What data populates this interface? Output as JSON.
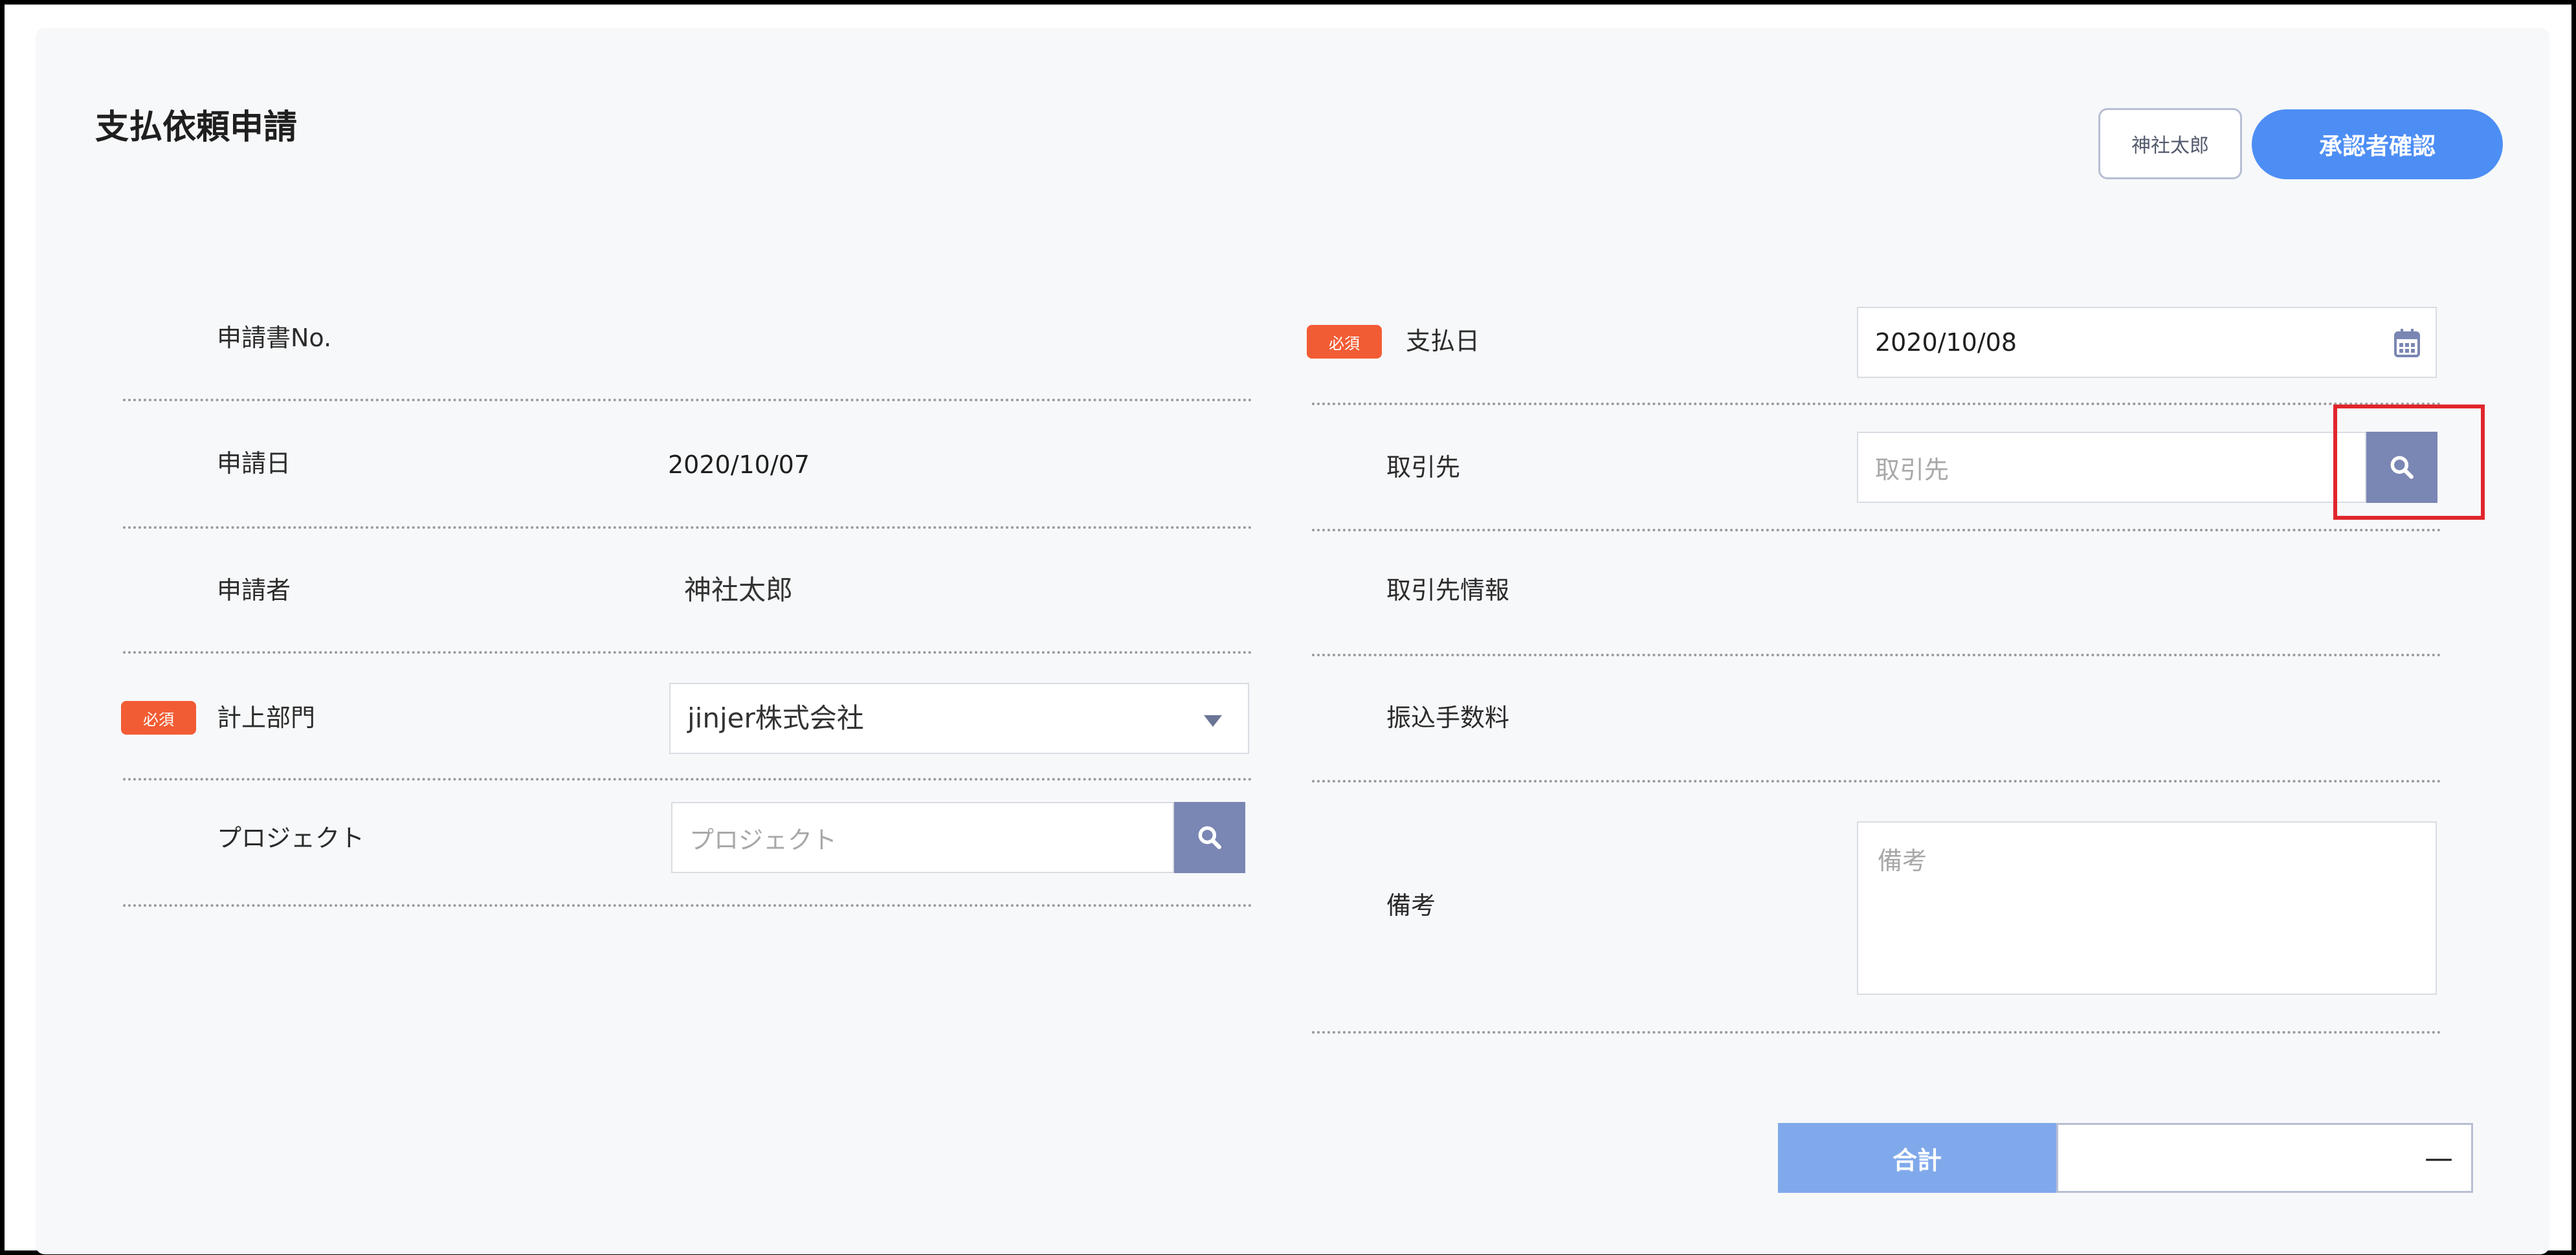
{
  "header": {
    "title": "支払依頼申請",
    "user_name": "神社太郎",
    "approver_button": "承認者確認"
  },
  "left_form": {
    "application_no_label": "申請書No.",
    "application_no_value": "",
    "application_date_label": "申請日",
    "application_date_value": "2020/10/07",
    "applicant_label": "申請者",
    "applicant_value": "神社太郎",
    "department_label": "計上部門",
    "department_value": "jinjer株式会社",
    "project_label": "プロジェクト",
    "project_placeholder": "プロジェクト"
  },
  "right_form": {
    "payment_date_label": "支払日",
    "payment_date_value": "2020/10/08",
    "vendor_label": "取引先",
    "vendor_placeholder": "取引先",
    "vendor_info_label": "取引先情報",
    "transfer_fee_label": "振込手数料",
    "remarks_label": "備考",
    "remarks_placeholder": "備考"
  },
  "badges": {
    "required": "必須"
  },
  "total": {
    "label": "合計",
    "value": "—"
  },
  "colors": {
    "accent": "#4d8ef5",
    "required_badge": "#f25c34",
    "search_button": "#7a86b3",
    "highlight": "#e0262c",
    "total_label_bg": "#80a9eb"
  },
  "icons": {
    "calendar": "calendar-icon",
    "search": "search-icon",
    "dropdown": "caret-down-icon"
  }
}
